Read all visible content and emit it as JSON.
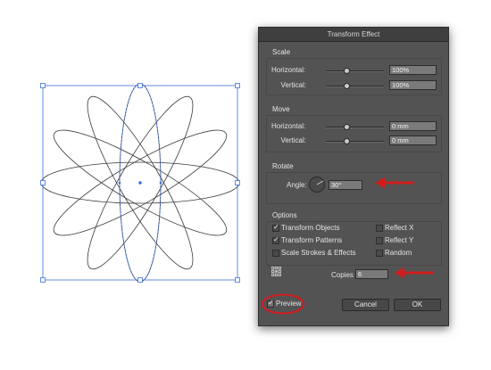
{
  "dialog": {
    "title": "Transform Effect",
    "scale": {
      "title": "Scale",
      "horizontal_label": "Horizontal:",
      "horizontal_value": "100%",
      "vertical_label": "Vertical:",
      "vertical_value": "100%"
    },
    "move": {
      "title": "Move",
      "horizontal_label": "Horizontal:",
      "horizontal_value": "0 mm",
      "vertical_label": "Vertical:",
      "vertical_value": "0 mm"
    },
    "rotate": {
      "title": "Rotate",
      "angle_label": "Angle:",
      "angle_value": "30°"
    },
    "options": {
      "title": "Options",
      "transform_objects": "Transform Objects",
      "transform_objects_checked": true,
      "transform_patterns": "Transform Patterns",
      "transform_patterns_checked": true,
      "scale_strokes": "Scale Strokes & Effects",
      "scale_strokes_checked": false,
      "reflect_x": "Reflect X",
      "reflect_x_checked": false,
      "reflect_y": "Reflect Y",
      "reflect_y_checked": false,
      "random": "Random",
      "random_checked": false
    },
    "copies_label": "Copies",
    "copies_value": "6",
    "preview_label": "Preview",
    "preview_checked": true,
    "cancel_label": "Cancel",
    "ok_label": "OK"
  },
  "colors": {
    "dialog_bg": "#535353",
    "selection_blue": "#3d6fd6",
    "annotation_red": "#d01c1c"
  },
  "icons": [
    "reference-point-icon",
    "angle-dial-icon",
    "check-icon",
    "red-arrow-icon",
    "red-circle-highlight"
  ]
}
